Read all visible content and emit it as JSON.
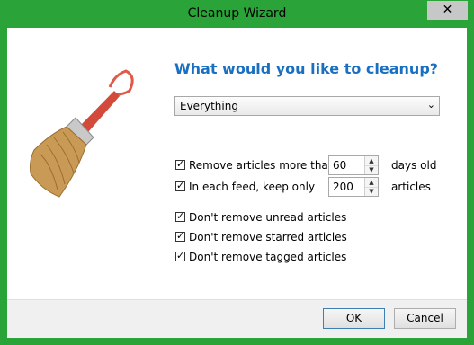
{
  "window": {
    "title": "Cleanup Wizard",
    "close_glyph": "✕"
  },
  "heading": "What would you like to cleanup?",
  "scope_select": {
    "value": "Everything",
    "arrow": "⌄"
  },
  "options": {
    "older_than": {
      "label": "Remove articles more than",
      "value": "60",
      "suffix": "days old",
      "checked": true
    },
    "keep_only": {
      "label": "In each feed, keep only",
      "value": "200",
      "suffix": "articles",
      "checked": true
    },
    "unread": {
      "label": "Don't remove unread articles",
      "checked": true
    },
    "starred": {
      "label": "Don't remove starred articles",
      "checked": true
    },
    "tagged": {
      "label": "Don't remove tagged articles",
      "checked": true
    }
  },
  "buttons": {
    "ok": "OK",
    "cancel": "Cancel"
  },
  "icons": {
    "broom": "broom-icon"
  },
  "colors": {
    "frame": "#2aa338",
    "heading": "#1a6fc1"
  }
}
